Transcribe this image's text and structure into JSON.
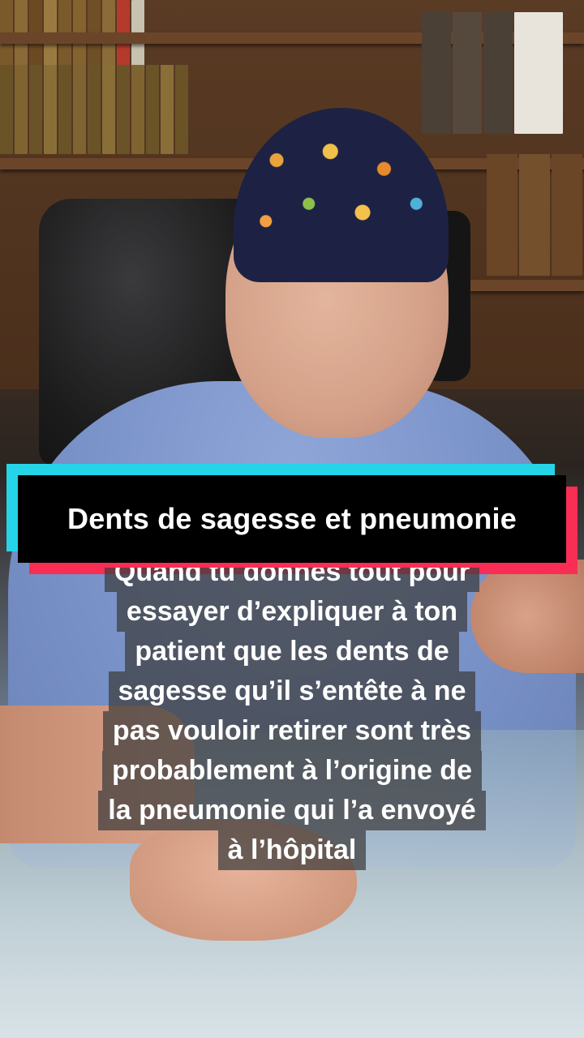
{
  "title": "Dents de sagesse et pneumonie",
  "caption": {
    "lines": [
      "Quand tu donnes tout pour",
      "essayer d’expliquer à ton",
      "patient que les dents de",
      "sagesse qu’il s’entête à ne",
      "pas vouloir retirer sont très",
      "probablement à l’origine de",
      "la pneumonie qui l’a envoyé",
      "à l’hôpital"
    ]
  },
  "colors": {
    "banner_cyan": "#25d4e8",
    "banner_red": "#fa2d55",
    "banner_black": "#000000",
    "caption_background": "rgba(60,60,60,0.72)"
  }
}
